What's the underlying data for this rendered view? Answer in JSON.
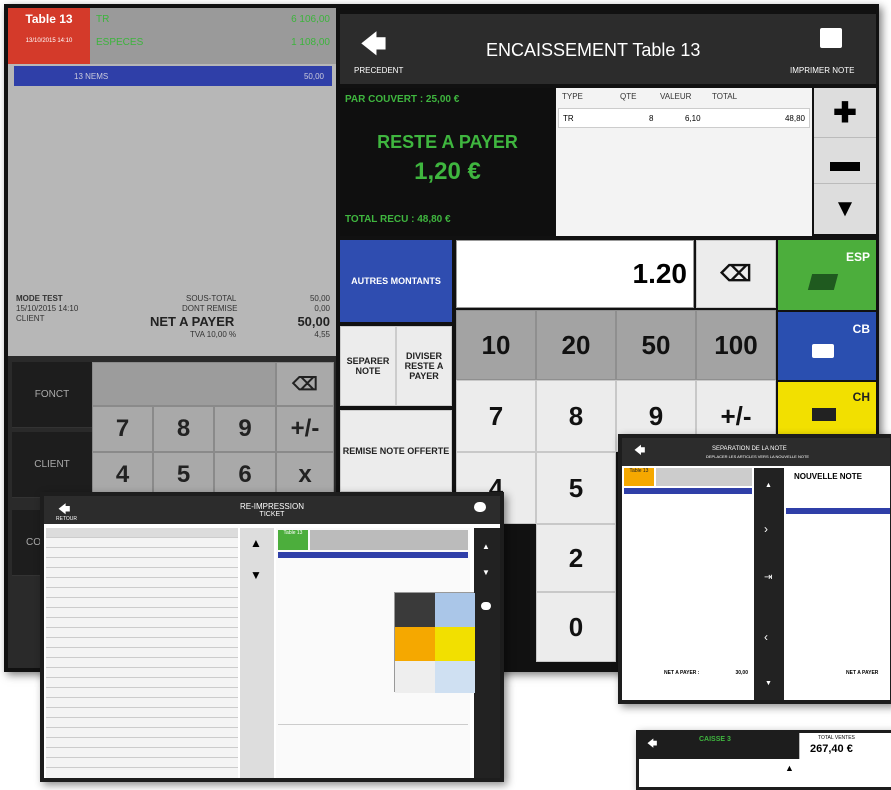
{
  "left_pane": {
    "table_label": "Table 13",
    "table_sub": "13/10/2015 14:10",
    "top_line1_left": "TR",
    "top_line1_right": "6 106,00",
    "top_line2_left": "ESPECES",
    "top_line2_right": "1 108,00",
    "selected_row_left": "13 NEMS",
    "selected_row_right": "50,00",
    "mode": "MODE TEST",
    "datetime": "15/10/2015 14:10",
    "client": "CLIENT",
    "sous_total_label": "SOUS-TOTAL",
    "sous_total": "50,00",
    "dont_remise_label": "DONT REMISE",
    "dont_remise": "0,00",
    "net_label": "NET A PAYER",
    "net_value": "50,00",
    "tva_label": "TVA 10,00 %",
    "tva_value": "4,55",
    "fonct": "FONCT",
    "client_btn": "CLIENT",
    "co_btn": "CO",
    "keys": [
      "7",
      "8",
      "9",
      "+/-",
      "4",
      "5",
      "6",
      "x"
    ]
  },
  "encaissement": {
    "back_label": "PRECEDENT",
    "title": "ENCAISSEMENT  Table 13",
    "print_label": "IMPRIMER NOTE",
    "par_couvert": "PAR COUVERT : 25,00 €",
    "reste_label": "RESTE A PAYER",
    "reste_value": "1,20 €",
    "total_recu": "TOTAL RECU : 48,80 €",
    "table_headers": [
      "TYPE",
      "QTE",
      "VALEUR",
      "TOTAL"
    ],
    "table_rows": [
      [
        "TR",
        "8",
        "6,10",
        "48,80"
      ]
    ],
    "amount_input": "1.20",
    "autres_montants": "AUTRES MONTANTS",
    "separer_note": "SEPARER NOTE",
    "diviser_reste": "DIVISER RESTE A PAYER",
    "remise_note": "REMISE NOTE OFFERTE",
    "num_keys_top": [
      "10",
      "20",
      "50",
      "100"
    ],
    "num_keys_row2": [
      "7",
      "8",
      "9",
      "+/-"
    ],
    "num_keys_col": [
      "4",
      "5",
      "2",
      "0"
    ],
    "pay_esp": "ESP",
    "pay_cb": "CB",
    "pay_ch": "CH",
    "colors": {
      "green": "#4cae3c",
      "blue": "#2a4fb0",
      "yellow": "#f2e000",
      "dark": "#111111"
    }
  },
  "reimpression": {
    "title_line1": "RE-IMPRESSION",
    "title_line2": "TICKET",
    "back_label": "RETOUR",
    "table_badge": "Table 13",
    "icons": [
      "print-icon",
      "arrow-up-icon",
      "arrow-down-icon"
    ]
  },
  "separation": {
    "title": "SEPARATION DE LA NOTE",
    "subtitle": "DEPLACER LES ARTICLES VERS LA NOUVELLE NOTE",
    "new_note": "NOUVELLE NOTE",
    "badge": "Table 13",
    "net_left": "NET A PAYER :",
    "net_left_value": "30,00",
    "net_right": "NET A PAYER"
  },
  "mini": {
    "title": "CAISSE 3",
    "total_label": "TOTAL VENTES",
    "total_value": "267,40 €"
  }
}
